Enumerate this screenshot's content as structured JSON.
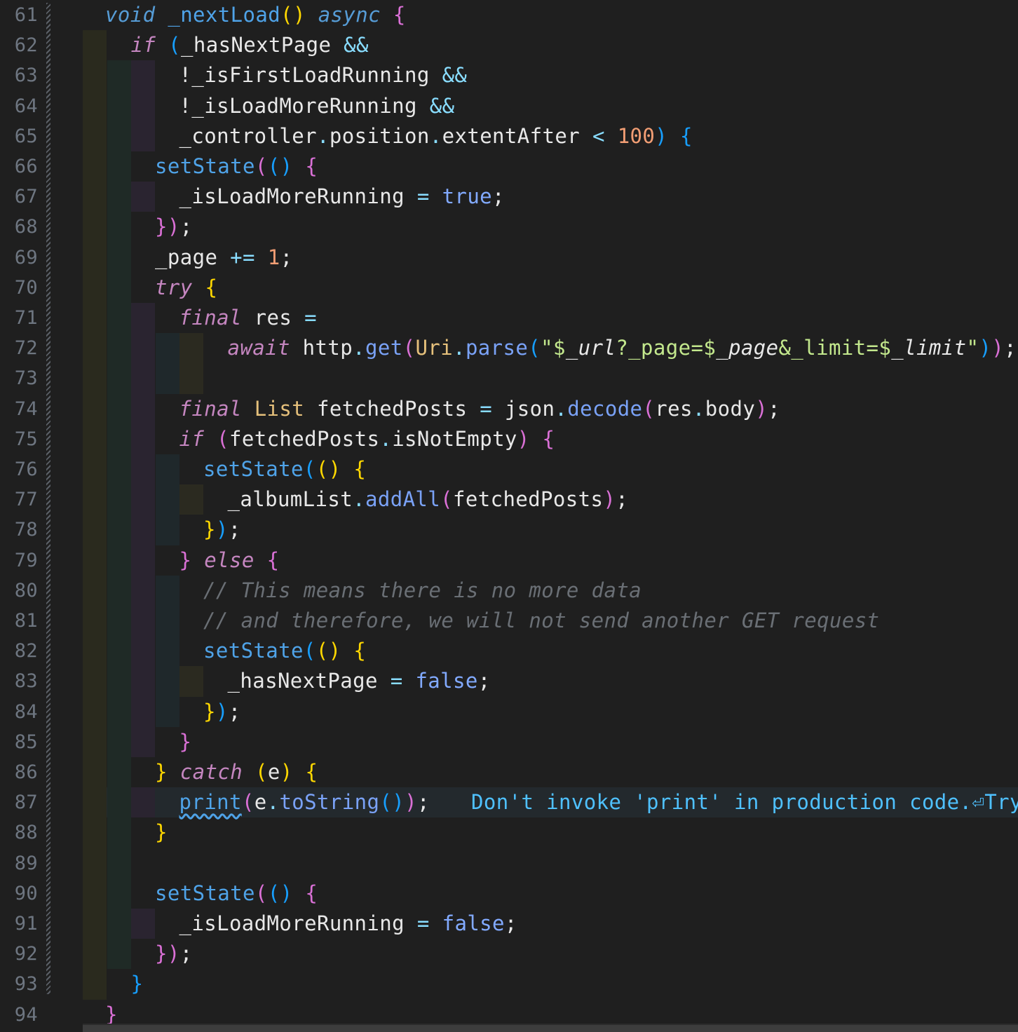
{
  "editor": {
    "language": "Dart",
    "first_line_number": 61,
    "last_line_number": 94,
    "cursor_line": 87,
    "colors": {
      "background": "#1f1f1f",
      "keyword": "#c586c0",
      "function": "#4fa3e8",
      "string": "#c3e88d",
      "number": "#f29e74",
      "comment": "#6a6f75",
      "diagnostic": "#4fc1ff"
    },
    "lines": [
      {
        "n": "61",
        "tokens": [
          [
            "kb",
            "void"
          ],
          [
            "id",
            " "
          ],
          [
            "fn",
            "_nextLoad"
          ],
          [
            "p1",
            "()"
          ],
          [
            "id",
            " "
          ],
          [
            "kb",
            "async"
          ],
          [
            "id",
            " "
          ],
          [
            "p2",
            "{"
          ]
        ]
      },
      {
        "n": "62",
        "tokens": [
          [
            "k",
            "if"
          ],
          [
            "id",
            " "
          ],
          [
            "p3",
            "("
          ],
          [
            "id",
            "_hasNextPage "
          ],
          [
            "op",
            "&&"
          ]
        ]
      },
      {
        "n": "63",
        "tokens": [
          [
            "id",
            "!_isFirstLoadRunning "
          ],
          [
            "op",
            "&&"
          ]
        ]
      },
      {
        "n": "64",
        "tokens": [
          [
            "id",
            "!_isLoadMoreRunning "
          ],
          [
            "op",
            "&&"
          ]
        ]
      },
      {
        "n": "65",
        "tokens": [
          [
            "id",
            "_controller"
          ],
          [
            "op",
            "."
          ],
          [
            "id",
            "position"
          ],
          [
            "op",
            "."
          ],
          [
            "id",
            "extentAfter "
          ],
          [
            "op",
            "<"
          ],
          [
            "id",
            " "
          ],
          [
            "num",
            "100"
          ],
          [
            "p3",
            ")"
          ],
          [
            "id",
            " "
          ],
          [
            "p3",
            "{"
          ]
        ]
      },
      {
        "n": "66",
        "tokens": [
          [
            "fn",
            "setState"
          ],
          [
            "p2",
            "("
          ],
          [
            "p3",
            "()"
          ],
          [
            "id",
            " "
          ],
          [
            "p2",
            "{"
          ]
        ]
      },
      {
        "n": "67",
        "tokens": [
          [
            "id",
            "_isLoadMoreRunning "
          ],
          [
            "op",
            "="
          ],
          [
            "id",
            " "
          ],
          [
            "bool",
            "true"
          ],
          [
            "id",
            ";"
          ]
        ]
      },
      {
        "n": "68",
        "tokens": [
          [
            "p2",
            "}"
          ],
          [
            "p2",
            ")"
          ],
          [
            "id",
            ";"
          ]
        ]
      },
      {
        "n": "69",
        "tokens": [
          [
            "id",
            "_page "
          ],
          [
            "op",
            "+="
          ],
          [
            "id",
            " "
          ],
          [
            "num",
            "1"
          ],
          [
            "id",
            ";"
          ]
        ]
      },
      {
        "n": "70",
        "tokens": [
          [
            "k",
            "try"
          ],
          [
            "id",
            " "
          ],
          [
            "p1",
            "{"
          ]
        ]
      },
      {
        "n": "71",
        "tokens": [
          [
            "k",
            "final"
          ],
          [
            "id",
            " res "
          ],
          [
            "op",
            "="
          ]
        ]
      },
      {
        "n": "72",
        "tokens": [
          [
            "k",
            "await"
          ],
          [
            "id",
            " http"
          ],
          [
            "op",
            "."
          ],
          [
            "fm",
            "get"
          ],
          [
            "p2",
            "("
          ],
          [
            "ty",
            "Uri"
          ],
          [
            "op",
            "."
          ],
          [
            "fm",
            "parse"
          ],
          [
            "p3",
            "("
          ],
          [
            "str",
            "\"$"
          ],
          [
            "istr",
            "_url"
          ],
          [
            "str",
            "?_page=$"
          ],
          [
            "istr",
            "_page"
          ],
          [
            "str",
            "&_limit=$"
          ],
          [
            "istr",
            "_limit"
          ],
          [
            "str",
            "\""
          ],
          [
            "p3",
            ")"
          ],
          [
            "p2",
            ")"
          ],
          [
            "id",
            ";"
          ]
        ]
      },
      {
        "n": "73",
        "tokens": []
      },
      {
        "n": "74",
        "tokens": [
          [
            "k",
            "final"
          ],
          [
            "id",
            " "
          ],
          [
            "ty",
            "List"
          ],
          [
            "id",
            " fetchedPosts "
          ],
          [
            "op",
            "="
          ],
          [
            "id",
            " json"
          ],
          [
            "op",
            "."
          ],
          [
            "fm",
            "decode"
          ],
          [
            "p2",
            "("
          ],
          [
            "id",
            "res"
          ],
          [
            "op",
            "."
          ],
          [
            "id",
            "body"
          ],
          [
            "p2",
            ")"
          ],
          [
            "id",
            ";"
          ]
        ]
      },
      {
        "n": "75",
        "tokens": [
          [
            "k",
            "if"
          ],
          [
            "id",
            " "
          ],
          [
            "p2",
            "("
          ],
          [
            "id",
            "fetchedPosts"
          ],
          [
            "op",
            "."
          ],
          [
            "id",
            "isNotEmpty"
          ],
          [
            "p2",
            ")"
          ],
          [
            "id",
            " "
          ],
          [
            "p2",
            "{"
          ]
        ]
      },
      {
        "n": "76",
        "tokens": [
          [
            "fn",
            "setState"
          ],
          [
            "p3",
            "("
          ],
          [
            "p1",
            "()"
          ],
          [
            "id",
            " "
          ],
          [
            "p1",
            "{"
          ]
        ]
      },
      {
        "n": "77",
        "tokens": [
          [
            "id",
            "_albumList"
          ],
          [
            "op",
            "."
          ],
          [
            "fm",
            "addAll"
          ],
          [
            "p2",
            "("
          ],
          [
            "id",
            "fetchedPosts"
          ],
          [
            "p2",
            ")"
          ],
          [
            "id",
            ";"
          ]
        ]
      },
      {
        "n": "78",
        "tokens": [
          [
            "p1",
            "}"
          ],
          [
            "p3",
            ")"
          ],
          [
            "id",
            ";"
          ]
        ]
      },
      {
        "n": "79",
        "tokens": [
          [
            "p2",
            "}"
          ],
          [
            "id",
            " "
          ],
          [
            "k",
            "else"
          ],
          [
            "id",
            " "
          ],
          [
            "p2",
            "{"
          ]
        ]
      },
      {
        "n": "80",
        "tokens": [
          [
            "com",
            "// This means there is no more data"
          ]
        ]
      },
      {
        "n": "81",
        "tokens": [
          [
            "com",
            "// and therefore, we will not send another GET request"
          ]
        ]
      },
      {
        "n": "82",
        "tokens": [
          [
            "fn",
            "setState"
          ],
          [
            "p3",
            "("
          ],
          [
            "p1",
            "()"
          ],
          [
            "id",
            " "
          ],
          [
            "p1",
            "{"
          ]
        ]
      },
      {
        "n": "83",
        "tokens": [
          [
            "id",
            "_hasNextPage "
          ],
          [
            "op",
            "="
          ],
          [
            "id",
            " "
          ],
          [
            "bool",
            "false"
          ],
          [
            "id",
            ";"
          ]
        ]
      },
      {
        "n": "84",
        "tokens": [
          [
            "p1",
            "}"
          ],
          [
            "p3",
            ")"
          ],
          [
            "id",
            ";"
          ]
        ]
      },
      {
        "n": "85",
        "tokens": [
          [
            "p2",
            "}"
          ]
        ]
      },
      {
        "n": "86",
        "tokens": [
          [
            "p1",
            "}"
          ],
          [
            "id",
            " "
          ],
          [
            "k",
            "catch"
          ],
          [
            "id",
            " "
          ],
          [
            "p1",
            "("
          ],
          [
            "id",
            "e"
          ],
          [
            "p1",
            ")"
          ],
          [
            "id",
            " "
          ],
          [
            "p1",
            "{"
          ]
        ]
      },
      {
        "n": "87",
        "tokens": [
          [
            "fn squig",
            "print"
          ],
          [
            "p2",
            "("
          ],
          [
            "id",
            "e"
          ],
          [
            "op",
            "."
          ],
          [
            "fm",
            "toString"
          ],
          [
            "p3",
            "()"
          ],
          [
            "p2",
            ")"
          ],
          [
            "id",
            ";"
          ]
        ]
      },
      {
        "n": "88",
        "tokens": [
          [
            "p1",
            "}"
          ]
        ]
      },
      {
        "n": "89",
        "tokens": []
      },
      {
        "n": "90",
        "tokens": [
          [
            "fn",
            "setState"
          ],
          [
            "p2",
            "("
          ],
          [
            "p3",
            "()"
          ],
          [
            "id",
            " "
          ],
          [
            "p2",
            "{"
          ]
        ]
      },
      {
        "n": "91",
        "tokens": [
          [
            "id",
            "_isLoadMoreRunning "
          ],
          [
            "op",
            "="
          ],
          [
            "id",
            " "
          ],
          [
            "bool",
            "false"
          ],
          [
            "id",
            ";"
          ]
        ]
      },
      {
        "n": "92",
        "tokens": [
          [
            "p2",
            "}"
          ],
          [
            "p2",
            ")"
          ],
          [
            "id",
            ";"
          ]
        ]
      },
      {
        "n": "93",
        "tokens": [
          [
            "p3",
            "}"
          ]
        ]
      },
      {
        "n": "94",
        "tokens": [
          [
            "p2",
            "}"
          ]
        ]
      }
    ],
    "inline_diagnostic": {
      "line": "87",
      "message": "Don't invoke 'print' in production code.⏎Try"
    }
  }
}
